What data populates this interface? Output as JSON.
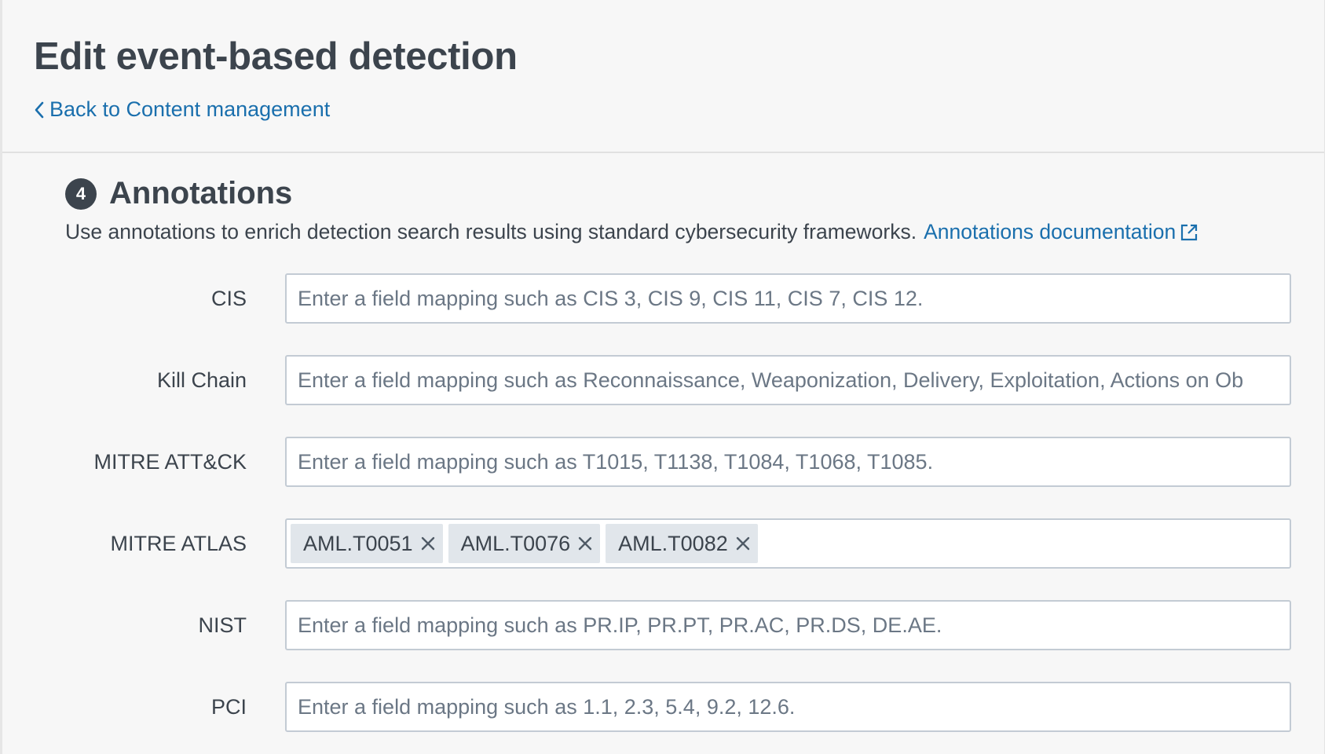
{
  "header": {
    "title": "Edit event-based detection",
    "back_link": "Back to Content management"
  },
  "section": {
    "step": "4",
    "title": "Annotations",
    "description": "Use annotations to enrich detection search results using standard cybersecurity frameworks.",
    "doc_link": "Annotations documentation"
  },
  "fields": {
    "cis": {
      "label": "CIS",
      "placeholder": "Enter a field mapping such as CIS 3, CIS 9, CIS 11, CIS 7, CIS 12."
    },
    "kill_chain": {
      "label": "Kill Chain",
      "placeholder": "Enter a field mapping such as Reconnaissance, Weaponization, Delivery, Exploitation, Actions on Ob"
    },
    "mitre_attack": {
      "label": "MITRE ATT&CK",
      "placeholder": "Enter a field mapping such as T1015, T1138, T1084, T1068, T1085."
    },
    "mitre_atlas": {
      "label": "MITRE ATLAS",
      "tags": [
        "AML.T0051",
        "AML.T0076",
        "AML.T0082"
      ]
    },
    "nist": {
      "label": "NIST",
      "placeholder": "Enter a field mapping such as PR.IP, PR.PT, PR.AC, PR.DS, DE.AE."
    },
    "pci": {
      "label": "PCI",
      "placeholder": "Enter a field mapping such as 1.1, 2.3, 5.4, 9.2, 12.6."
    }
  },
  "colors": {
    "text": "#3c444d",
    "link": "#1a6fad",
    "border": "#c3cbd4",
    "tag_bg": "#e1e6eb",
    "background": "#f7f7f7"
  },
  "icons": {
    "back": "chevron-left-icon",
    "external": "external-link-icon",
    "remove": "close-icon"
  }
}
